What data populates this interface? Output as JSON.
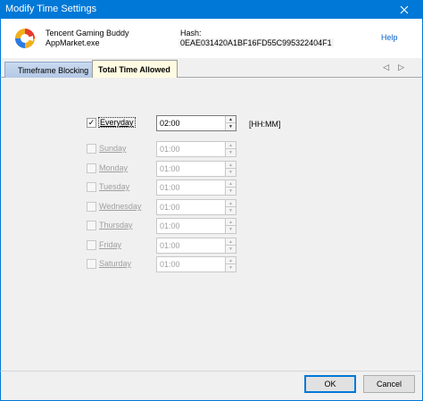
{
  "window": {
    "title": "Modify Time Settings",
    "close_glyph": "✕"
  },
  "app": {
    "name": "Tencent Gaming Buddy",
    "exe": "AppMarket.exe",
    "hash_label": "Hash:",
    "hash_value": "0EAE031420A1BF16FD55C995322404F1",
    "icon": "tencent-gaming-buddy-logo"
  },
  "help_label": "Help",
  "tabs": [
    {
      "label": "Timeframe Blocking",
      "active": false
    },
    {
      "label": "Total Time Allowed",
      "active": true
    }
  ],
  "tab_nav": {
    "prev": "◁",
    "next": "▷"
  },
  "units_label": "[HH:MM]",
  "schedule": [
    {
      "day": "Everyday",
      "checked": true,
      "enabled": true,
      "time": "02:00"
    },
    {
      "day": "Sunday",
      "checked": false,
      "enabled": false,
      "time": "01:00"
    },
    {
      "day": "Monday",
      "checked": false,
      "enabled": false,
      "time": "01:00"
    },
    {
      "day": "Tuesday",
      "checked": false,
      "enabled": false,
      "time": "01:00"
    },
    {
      "day": "Wednesday",
      "checked": false,
      "enabled": false,
      "time": "01:00"
    },
    {
      "day": "Thursday",
      "checked": false,
      "enabled": false,
      "time": "01:00"
    },
    {
      "day": "Friday",
      "checked": false,
      "enabled": false,
      "time": "01:00"
    },
    {
      "day": "Saturday",
      "checked": false,
      "enabled": false,
      "time": "01:00"
    }
  ],
  "footer": {
    "ok_label": "OK",
    "cancel_label": "Cancel"
  },
  "colors": {
    "titlebar": "#0078d7",
    "active_tab": "#fffbe2",
    "link": "#0b62c4"
  }
}
